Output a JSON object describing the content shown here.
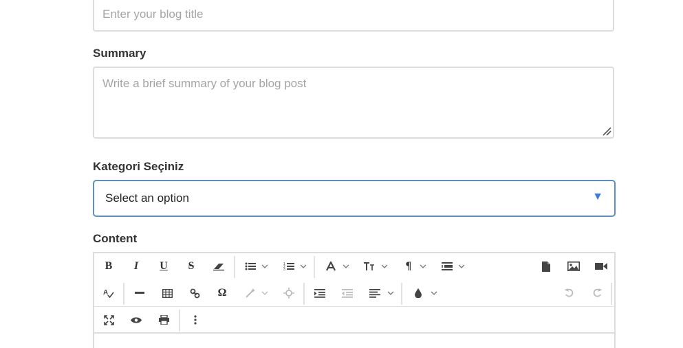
{
  "form": {
    "title": {
      "placeholder": "Enter your blog title"
    },
    "summary": {
      "label": "Summary",
      "placeholder": "Write a brief summary of your blog post"
    },
    "category": {
      "label": "Kategori Seçiniz",
      "selected": "Select an option",
      "arrow": "▼"
    },
    "content": {
      "label": "Content"
    }
  },
  "toolbar": {
    "bold": "B",
    "italic": "I",
    "underline": "U",
    "strike": "S",
    "font_size": "TT",
    "paragraph": "¶",
    "special_char": "Ω",
    "icons": [
      "bold-icon",
      "italic-icon",
      "underline-icon",
      "strikethrough-icon",
      "eraser-icon",
      "bullet-list-icon",
      "numbered-list-icon",
      "font-color-icon",
      "font-size-icon",
      "paragraph-icon",
      "line-height-icon",
      "file-icon",
      "image-icon",
      "video-icon",
      "spellcheck-icon",
      "horizontal-rule-icon",
      "table-icon",
      "link-icon",
      "omega-icon",
      "magic-wand-icon",
      "unlink-icon",
      "indent-icon",
      "outdent-icon",
      "align-left-icon",
      "color-drop-icon",
      "undo-icon",
      "redo-icon",
      "fullscreen-icon",
      "preview-eye-icon",
      "print-icon",
      "more-vertical-icon"
    ]
  },
  "colors": {
    "focus_border": "#5b8ec8",
    "arrow": "#3b7dd8",
    "border": "#dcdcdc",
    "placeholder": "#a4a4a4"
  }
}
